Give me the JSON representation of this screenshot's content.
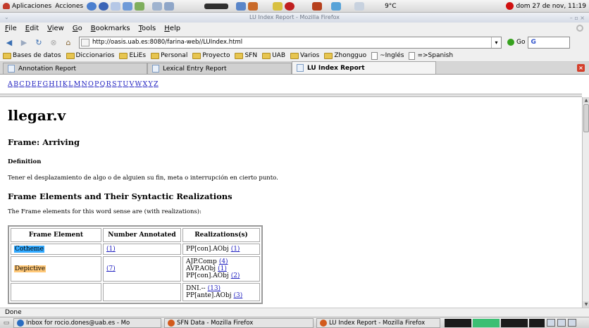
{
  "top_panel": {
    "applications": "Aplicaciones",
    "actions": "Acciones",
    "weather": "9°C",
    "clock": "dom 27 de nov, 11:19"
  },
  "window": {
    "title": "LU Index Report - Mozilla Firefox"
  },
  "menu": [
    "File",
    "Edit",
    "View",
    "Go",
    "Bookmarks",
    "Tools",
    "Help"
  ],
  "nav": {
    "url": "http://oasis.uab.es:8080/farina-web//LUIndex.html",
    "go_label": "Go",
    "search_label": "G"
  },
  "bookmarks": [
    {
      "label": "Bases de datos",
      "type": "folder"
    },
    {
      "label": "Diccionarios",
      "type": "folder"
    },
    {
      "label": "ELiEs",
      "type": "folder"
    },
    {
      "label": "Personal",
      "type": "folder"
    },
    {
      "label": "Proyecto",
      "type": "folder"
    },
    {
      "label": "SFN",
      "type": "folder"
    },
    {
      "label": "UAB",
      "type": "folder"
    },
    {
      "label": "Varios",
      "type": "folder"
    },
    {
      "label": "Zhongguo",
      "type": "folder"
    },
    {
      "label": "~Inglés",
      "type": "page"
    },
    {
      "label": "=>Spanish",
      "type": "page"
    }
  ],
  "tabs": [
    {
      "label": "Annotation Report",
      "active": false
    },
    {
      "label": "Lexical Entry Report",
      "active": false
    },
    {
      "label": "LU Index Report",
      "active": true
    }
  ],
  "alphabet": [
    "A",
    "B",
    "C",
    "D",
    "E",
    "F",
    "G",
    "H",
    "I",
    "J",
    "K",
    "L",
    "M",
    "N",
    "O",
    "P",
    "Q",
    "R",
    "S",
    "T",
    "U",
    "V",
    "W",
    "X",
    "Y",
    "Z"
  ],
  "doc": {
    "title": "llegar.v",
    "frame": "Frame: Arriving",
    "definition_heading": "Definition",
    "definition": "Tener el desplazamiento de algo o de alguien su fin, meta o interrupción en cierto punto.",
    "fe_heading": "Frame Elements and Their Syntactic Realizations",
    "fe_intro": "The Frame elements for this word sense are (with realizations):",
    "table": {
      "headers": [
        "Frame Element",
        "Number Annotated",
        "Realizations(s)"
      ],
      "rows": [
        {
          "fe": "Cotheme",
          "fe_color": "#33aaff",
          "count": "(1)",
          "realizations": [
            {
              "text": "PP[con].AObj",
              "link": "(1)"
            }
          ]
        },
        {
          "fe": "Depictive",
          "fe_color": "#ffc878",
          "count": "(7)",
          "realizations": [
            {
              "text": "AJP.Comp",
              "link": "(4)"
            },
            {
              "text": "AVP.AObj",
              "link": "(1)"
            },
            {
              "text": "PP[con].AObj",
              "link": "(2)"
            }
          ]
        },
        {
          "fe": "",
          "fe_color": "",
          "count": "",
          "realizations": [
            {
              "text": "DNI.--",
              "link": "(13)"
            },
            {
              "text": "PP[ante].AObj",
              "link": "(3)"
            }
          ]
        }
      ]
    }
  },
  "status": "Done",
  "taskbar": [
    {
      "label": "Inbox for rocio.dones@uab.es - Mo",
      "color": "#2a6cc0"
    },
    {
      "label": "SFN Data - Mozilla Firefox",
      "color": "#d25a1c"
    },
    {
      "label": "LU Index Report - Mozilla Firefox",
      "color": "#d25a1c"
    }
  ]
}
